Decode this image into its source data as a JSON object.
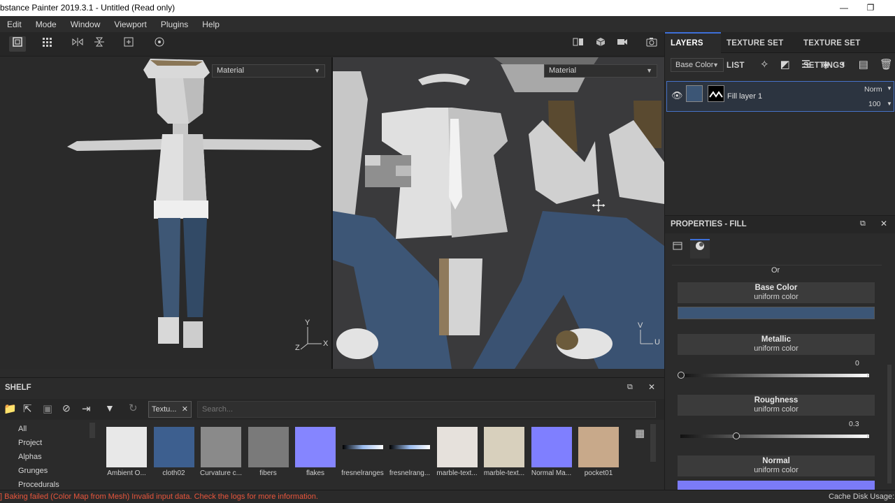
{
  "window": {
    "title": "bstance Painter 2019.3.1 - Untitled (Read only)",
    "minimize": "—",
    "maximize": "❐"
  },
  "menu": [
    "Edit",
    "Mode",
    "Window",
    "Viewport",
    "Plugins",
    "Help"
  ],
  "viewport": {
    "left_material": "Material",
    "right_material": "Material",
    "axis_x": "X",
    "axis_y": "Y",
    "axis_z": "Z",
    "axis_u": "U",
    "axis_v": "V"
  },
  "layers_panel": {
    "tabs": [
      "LAYERS",
      "TEXTURE SET LIST",
      "TEXTURE SET SETTINGS"
    ],
    "channel_select": "Base Color",
    "layer": {
      "name": "Fill layer 1",
      "blend_mode": "Norm",
      "opacity": "100"
    }
  },
  "properties": {
    "title": "PROPERTIES - FILL",
    "or_label": "Or",
    "channels": [
      {
        "name": "Base Color",
        "sub": "uniform color",
        "color": "#3c5676"
      },
      {
        "name": "Metallic",
        "sub": "uniform color",
        "value": "0",
        "level": 0.0
      },
      {
        "name": "Roughness",
        "sub": "uniform color",
        "value": "0.3",
        "level": 0.3
      },
      {
        "name": "Normal",
        "sub": "uniform color",
        "color": "#7b7bf7"
      }
    ]
  },
  "shelf": {
    "title": "SHELF",
    "filter_tag": "Textu...",
    "search_placeholder": "Search...",
    "categories": [
      "All",
      "Project",
      "Alphas",
      "Grunges",
      "Procedurals"
    ],
    "items": [
      {
        "label": "Ambient O...",
        "color": "#e8e8e8"
      },
      {
        "label": "cloth02",
        "color": "#3d5f8f"
      },
      {
        "label": "Curvature c...",
        "color": "#8a8a8a"
      },
      {
        "label": "fibers",
        "color": "#7a7a7a"
      },
      {
        "label": "flakes",
        "color": "#8585ff"
      },
      {
        "label": "fresnelranges",
        "color": "#111111"
      },
      {
        "label": "fresnelrang...",
        "color": "#1c1c1c"
      },
      {
        "label": "marble-text...",
        "color": "#e6e1dc"
      },
      {
        "label": "marble-text...",
        "color": "#d8d0bd"
      },
      {
        "label": "Normal Ma...",
        "color": "#7f7fff"
      },
      {
        "label": "pocket01",
        "color": "#c8a98a"
      }
    ]
  },
  "status": {
    "error": "] Baking failed (Color Map from Mesh) Invalid input data. Check the logs for more information.",
    "cache": "Cache Disk Usage:"
  },
  "colors": {
    "accent": "#3d6fd8",
    "error": "#e8553c"
  }
}
